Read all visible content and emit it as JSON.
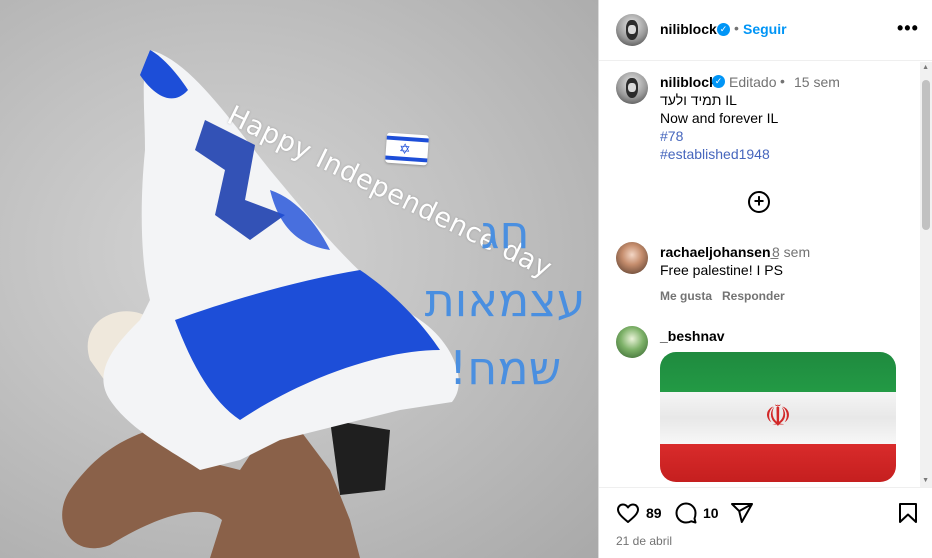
{
  "photo": {
    "overlay_english": "Happy Independence day",
    "overlay_hebrew_lines": [
      "חג",
      "עצמאות",
      "שמח!"
    ],
    "flag_emoji": "israel-flag-emoji",
    "colors": {
      "background": "#c2c2c2",
      "flag_blue": "#1d4ed8",
      "hebrew_text": "#4a8fe0"
    }
  },
  "header": {
    "username": "niliblock",
    "verified_mark": "✓",
    "separator": "•",
    "follow_label": "Seguir",
    "more_label": "•••"
  },
  "caption": {
    "username": "niliblock",
    "verified_mark": "✓",
    "edited": "Editado",
    "separator": "•",
    "time": "15 sem",
    "line1": "תמיד ולעד IL",
    "line2": "Now and forever IL",
    "tags": [
      "#78",
      "#established1948"
    ]
  },
  "add_button": "+",
  "comments": [
    {
      "username": "rachaeljohansen_",
      "time": "8 sem",
      "text": "Free palestine! I PS",
      "like_label": "Me gusta",
      "reply_label": "Responder"
    },
    {
      "username": "_beshnav",
      "media": "iran-flag-image"
    }
  ],
  "actions": {
    "likes": "89",
    "comments": "10",
    "date": "21 de abril"
  },
  "colors": {
    "link_blue": "#0095f6",
    "tag_blue": "#4666bd",
    "muted": "#737373"
  }
}
